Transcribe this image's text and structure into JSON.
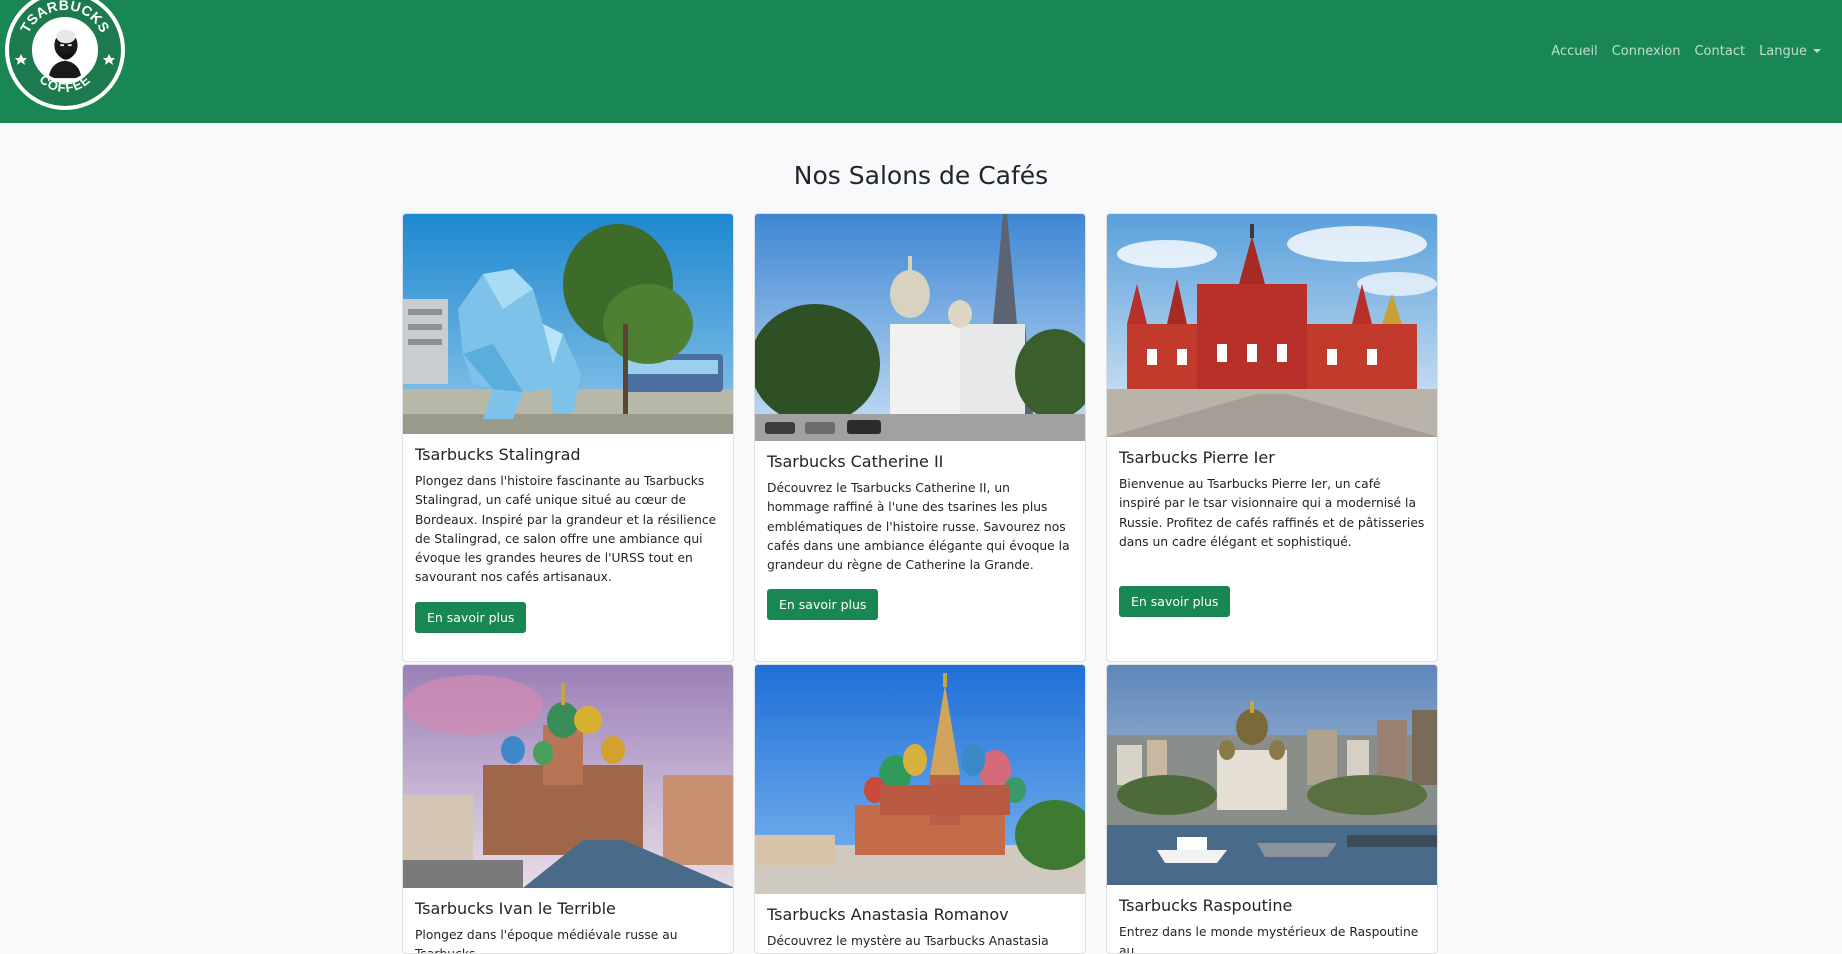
{
  "brand": {
    "logo_alt": "Tsarbucks Coffee logo",
    "logo_top_text": "TSARBUCKS",
    "logo_bottom_text": "COFFEE"
  },
  "nav": {
    "items": [
      {
        "label": "Accueil"
      },
      {
        "label": "Connexion"
      },
      {
        "label": "Contact"
      },
      {
        "label": "Langue"
      }
    ]
  },
  "main": {
    "title": "Nos Salons de Cafés",
    "cards": [
      {
        "title": "Tsarbucks Stalingrad",
        "text": "Plongez dans l'histoire fascinante au Tsarbucks Stalingrad, un café unique situé au cœur de Bordeaux. Inspiré par la grandeur et la résilience de Stalingrad, ce salon offre une ambiance qui évoque les grandes heures de l'URSS tout en savourant nos cafés artisanaux.",
        "button": "En savoir plus",
        "image": "blue-lion-statue-bordeaux"
      },
      {
        "title": "Tsarbucks Catherine II",
        "text": "Découvrez le Tsarbucks Catherine II, un hommage raffiné à l'une des tsarines les plus emblématiques de l'histoire russe. Savourez nos cafés dans une ambiance élégante qui évoque la grandeur du règne de Catherine la Grande.",
        "button": "En savoir plus",
        "image": "orthodox-cathedral-eiffel-tower"
      },
      {
        "title": "Tsarbucks Pierre Ier",
        "text": "Bienvenue au Tsarbucks Pierre Ier, un café inspiré par le tsar visionnaire qui a modernisé la Russie. Profitez de cafés raffinés et de pâtisseries dans un cadre élégant et sophistiqué.",
        "button": "En savoir plus",
        "image": "state-historical-museum-moscow"
      },
      {
        "title": "Tsarbucks Ivan le Terrible",
        "text": "Plongez dans l'époque médiévale russe au Tsarbucks",
        "image": "church-of-savior-on-blood"
      },
      {
        "title": "Tsarbucks Anastasia Romanov",
        "text": "Découvrez le mystère au Tsarbucks Anastasia",
        "image": "saint-basil-cathedral"
      },
      {
        "title": "Tsarbucks Raspoutine",
        "text": "Entrez dans le monde mystérieux de Raspoutine au",
        "image": "vladivostok-harbor-cathedral"
      }
    ]
  },
  "colors": {
    "navbar": "#198754",
    "button": "#198754",
    "page_bg": "#f8f9fa"
  }
}
